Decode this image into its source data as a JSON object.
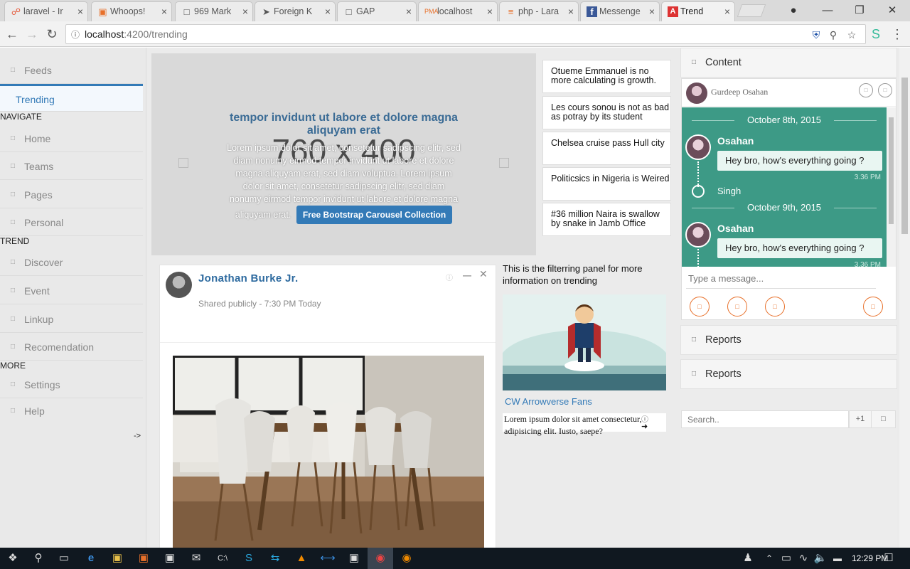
{
  "browser": {
    "tabs": [
      {
        "title": "laravel - Ir",
        "icon": "laravel-icon",
        "active": false
      },
      {
        "title": "Whoops!",
        "icon": "whoops-icon",
        "active": false
      },
      {
        "title": "969 Mark",
        "icon": "page-icon",
        "active": false
      },
      {
        "title": "Foreign K",
        "icon": "arrow-icon",
        "active": false
      },
      {
        "title": "GAP",
        "icon": "page-icon",
        "active": false
      },
      {
        "title": "localhost",
        "icon": "pma-icon",
        "active": false
      },
      {
        "title": "php - Lara",
        "icon": "stackoverflow-icon",
        "active": false
      },
      {
        "title": "Messenge",
        "icon": "facebook-icon",
        "active": false
      },
      {
        "title": "Trend",
        "icon": "angular-icon",
        "active": true
      }
    ],
    "url_host": "localhost",
    "url_path": ":4200/trending"
  },
  "sidebar": {
    "top_items": [
      {
        "label": "Feeds"
      },
      {
        "label": "Trending",
        "active": true
      }
    ],
    "sections": [
      {
        "heading": "NAVIGATE",
        "items": [
          "Home",
          "Teams",
          "Pages",
          "Personal"
        ]
      },
      {
        "heading": "TREND",
        "items": [
          "Discover",
          "Event",
          "Linkup",
          "Recomendation"
        ]
      },
      {
        "heading": "MORE",
        "items": [
          "Settings",
          "Help"
        ]
      }
    ],
    "toggle": "->"
  },
  "carousel": {
    "placeholder": "760 x 400",
    "title": "tempor invidunt ut labore et dolore magna aliquyam erat",
    "text": "Lorem ipsum dolor sit amet, consetetur sadipscing elitr, sed diam nonumy eirmod tempor invidunt ut labore et dolore magna aliquyam erat, sed diam voluptua. Lorem ipsum dolor sit amet, consetetur sadipscing elitr, sed diam nonumy eirmod tempor invidunt ut labore et dolore magna aliquyam erat.",
    "button": "Free Bootstrap Carousel Collection"
  },
  "news": [
    "Otueme Emmanuel is no more calculating is growth.",
    "Les cours sonou is not as bad as potray by its student",
    "Chelsea cruise pass Hull city",
    "Politicsics in Nigeria is Weired",
    "#36 million Naira is swallow by snake in Jamb Office"
  ],
  "post": {
    "author": "Jonathan Burke Jr.",
    "meta": "Shared publicly - 7:30 PM Today"
  },
  "filter": {
    "text": "This is the filterring panel for more information on trending",
    "link": "CW Arrowverse Fans",
    "caption": "Lorem ipsum dolor sit amet consectetur, adipisicing elit. Iusto, saepe?"
  },
  "right": {
    "content_title": "Content",
    "chat": {
      "user": "Gurdeep Osahan",
      "date1": "October 8th, 2015",
      "date2": "October 9th, 2015",
      "sender": "Osahan",
      "message": "Hey bro, how's everything going ?",
      "time": "3.36 PM",
      "other": "Singh",
      "input_placeholder": "Type a message..."
    },
    "reports1": "Reports",
    "reports2": "Reports",
    "search_placeholder": "Search..",
    "search_count": "+1"
  },
  "taskbar": {
    "time": "12:29 PM"
  },
  "colors": {
    "accent": "#337ab7",
    "chat": "#3d9a86",
    "action": "#e8702a"
  }
}
